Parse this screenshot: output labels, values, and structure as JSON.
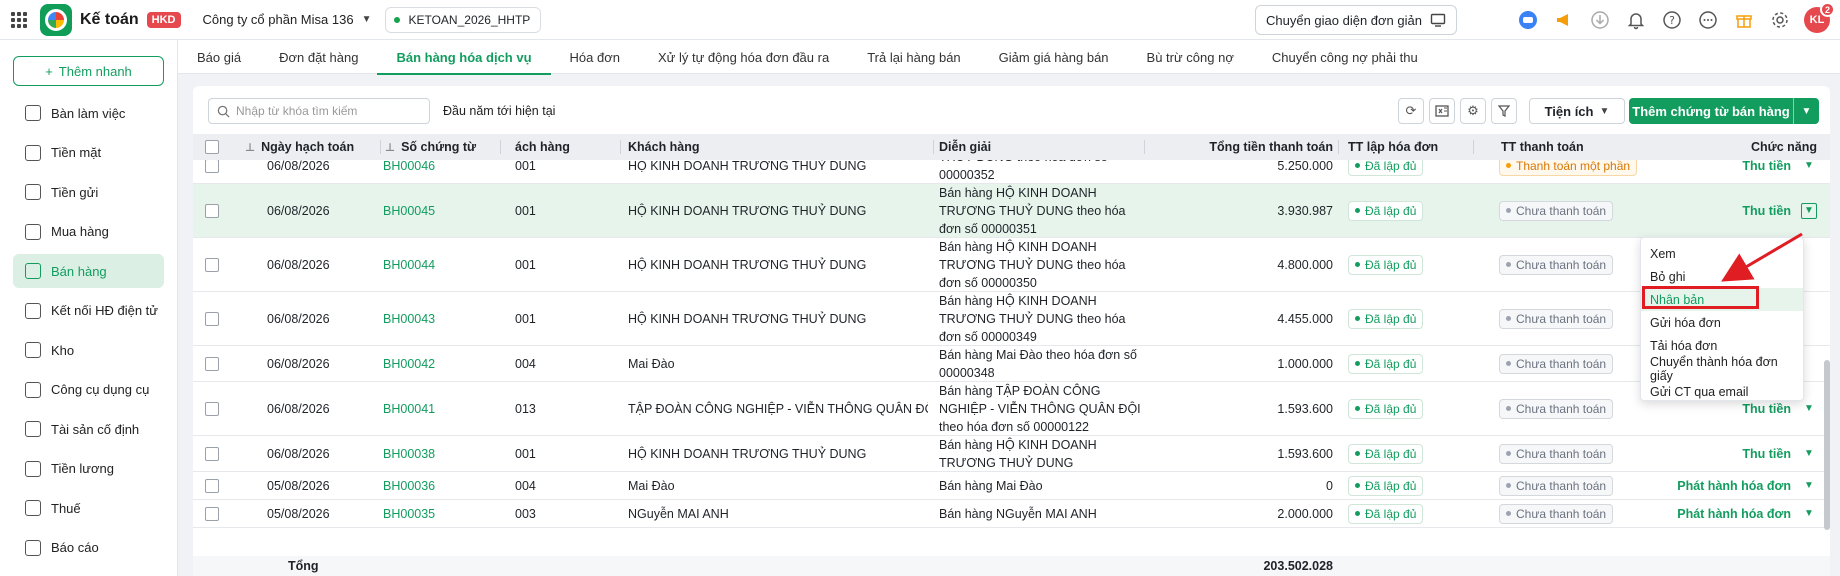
{
  "app": {
    "title": "Kế toán",
    "badge": "HKD",
    "company": "Công ty cổ phần Misa 136",
    "database": "KETOAN_2026_HHTP",
    "switch_ui": "Chuyển giao diện đơn giản",
    "avatar_initials": "KL",
    "avatar_badge": "2"
  },
  "sidebar": {
    "quick_add": "Thêm nhanh",
    "items": [
      {
        "label": "Bàn làm việc",
        "icon": "desk-icon"
      },
      {
        "label": "Tiền mặt",
        "icon": "cash-icon"
      },
      {
        "label": "Tiền gửi",
        "icon": "bank-deposit-icon"
      },
      {
        "label": "Mua hàng",
        "icon": "cart-icon"
      },
      {
        "label": "Bán hàng",
        "icon": "tag-icon",
        "active": true
      },
      {
        "label": "Kết nối HĐ điện tử",
        "icon": "e-invoice-icon"
      },
      {
        "label": "Kho",
        "icon": "box-icon"
      },
      {
        "label": "Công cụ dụng cụ",
        "icon": "tools-icon"
      },
      {
        "label": "Tài sản cố định",
        "icon": "asset-icon"
      },
      {
        "label": "Tiền lương",
        "icon": "salary-icon"
      },
      {
        "label": "Thuế",
        "icon": "tax-icon"
      },
      {
        "label": "Báo cáo",
        "icon": "report-icon"
      }
    ]
  },
  "tabs": [
    "Báo giá",
    "Đơn đặt hàng",
    "Bán hàng hóa dịch vụ",
    "Hóa đơn",
    "Xử lý tự động hóa đơn đầu ra",
    "Trả lại hàng bán",
    "Giảm giá hàng bán",
    "Bù trừ công nợ",
    "Chuyển công nợ phải thu"
  ],
  "active_tab": 2,
  "toolbar": {
    "search_placeholder": "Nhập từ khóa tìm kiếm",
    "period": "Đầu năm tới hiện tại",
    "utility": "Tiện ích",
    "add_label": "Thêm chứng từ bán hàng"
  },
  "table": {
    "headers": {
      "date": "Ngày hạch toán",
      "doc": "Số chứng từ",
      "cust_code": "ách hàng",
      "customer": "Khách hàng",
      "desc": "Diễn giải",
      "total": "Tổng tiền thanh toán",
      "invoice_status": "TT lập hóa đơn",
      "pay_status": "TT thanh toán",
      "action": "Chức năng"
    },
    "rows": [
      {
        "date": "06/08/2026",
        "doc": "BH00046",
        "code": "001",
        "customer": "HỘ KINH DOANH TRƯƠNG THUỶ DUNG",
        "desc": "THUỶ DUNG theo hóa đơn số 00000352",
        "total": "5.250.000",
        "inv": "Đã lập đủ",
        "pay": "Thanh toán một phần",
        "pay_type": "part",
        "action": "Thu tiền"
      },
      {
        "date": "06/08/2026",
        "doc": "BH00045",
        "code": "001",
        "customer": "HỘ KINH DOANH TRƯƠNG THUỶ DUNG",
        "desc": "Bán hàng HỘ KINH DOANH TRƯƠNG THUỶ DUNG theo hóa đơn số 00000351",
        "total": "3.930.987",
        "inv": "Đã lập đủ",
        "pay": "Chưa thanh toán",
        "pay_type": "none",
        "action": "Thu tiền",
        "highlight": true
      },
      {
        "date": "06/08/2026",
        "doc": "BH00044",
        "code": "001",
        "customer": "HỘ KINH DOANH TRƯƠNG THUỶ DUNG",
        "desc": "Bán hàng HỘ KINH DOANH TRƯƠNG THUỶ DUNG theo hóa đơn số 00000350",
        "total": "4.800.000",
        "inv": "Đã lập đủ",
        "pay": "Chưa thanh toán",
        "pay_type": "none",
        "action": ""
      },
      {
        "date": "06/08/2026",
        "doc": "BH00043",
        "code": "001",
        "customer": "HỘ KINH DOANH TRƯƠNG THUỶ DUNG",
        "desc": "Bán hàng HỘ KINH DOANH TRƯƠNG THUỶ DUNG theo hóa đơn số 00000349",
        "total": "4.455.000",
        "inv": "Đã lập đủ",
        "pay": "Chưa thanh toán",
        "pay_type": "none",
        "action": ""
      },
      {
        "date": "06/08/2026",
        "doc": "BH00042",
        "code": "004",
        "customer": "Mai Đào",
        "desc": "Bán hàng Mai Đào theo hóa đơn số 00000348",
        "total": "1.000.000",
        "inv": "Đã lập đủ",
        "pay": "Chưa thanh toán",
        "pay_type": "none",
        "action": ""
      },
      {
        "date": "06/08/2026",
        "doc": "BH00041",
        "code": "013",
        "customer": "TẬP ĐOÀN CÔNG NGHIỆP - VIỄN THÔNG QUÂN ĐỘI",
        "desc": "Bán hàng TẬP ĐOÀN CÔNG NGHIỆP - VIỄN THÔNG QUÂN ĐỘI theo hóa đơn số 00000122",
        "total": "1.593.600",
        "inv": "Đã lập đủ",
        "pay": "Chưa thanh toán",
        "pay_type": "none",
        "action": "Thu tiền"
      },
      {
        "date": "06/08/2026",
        "doc": "BH00038",
        "code": "001",
        "customer": "HỘ KINH DOANH TRƯƠNG THUỶ DUNG",
        "desc": "Bán hàng HỘ KINH DOANH TRƯƠNG THUỶ DUNG",
        "total": "1.593.600",
        "inv": "Đã lập đủ",
        "pay": "Chưa thanh toán",
        "pay_type": "none",
        "action": "Thu tiền"
      },
      {
        "date": "05/08/2026",
        "doc": "BH00036",
        "code": "004",
        "customer": "Mai Đào",
        "desc": "Bán hàng Mai Đào",
        "total": "0",
        "inv": "Đã lập đủ",
        "pay": "Chưa thanh toán",
        "pay_type": "none",
        "action": "Phát hành hóa đơn"
      },
      {
        "date": "05/08/2026",
        "doc": "BH00035",
        "code": "003",
        "customer": "NGuyễn MAI ANH",
        "desc": "Bán hàng NGuyễn MAI ANH",
        "total": "2.000.000",
        "inv": "Đã lập đủ",
        "pay": "Chưa thanh toán",
        "pay_type": "none",
        "action": "Phát hành hóa đơn"
      }
    ],
    "footer_label": "Tổng",
    "footer_total": "203.502.028"
  },
  "context_menu": {
    "items": [
      "Xem",
      "Bỏ ghi",
      "Nhân bản",
      "Gửi hóa đơn",
      "Tải hóa đơn",
      "Chuyển thành hóa đơn giấy",
      "Gửi CT qua email"
    ],
    "highlighted_index": 2
  },
  "colors": {
    "brand": "#129d5f",
    "highlight_box": "#e11d24",
    "warning": "#d97706"
  }
}
